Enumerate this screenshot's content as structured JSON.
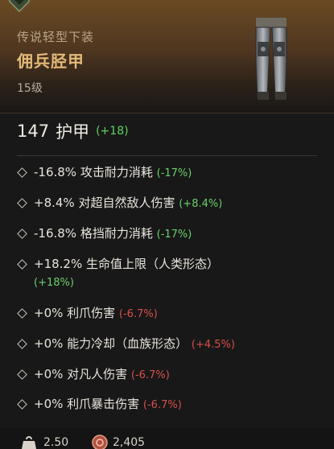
{
  "item": {
    "type": "传说轻型下装",
    "name": "佣兵胫甲",
    "level": "15级",
    "rarity_color": "#e3b979"
  },
  "armor": {
    "value": "147",
    "label": "护甲",
    "delta": "(+18)"
  },
  "stats": [
    {
      "text": "-16.8% 攻击耐力消耗",
      "delta": "(-17%)",
      "delta_color": "green"
    },
    {
      "text": "+8.4% 对超自然敌人伤害",
      "delta": "(+8.4%)",
      "delta_color": "green"
    },
    {
      "text": "-16.8% 格挡耐力消耗",
      "delta": "(-17%)",
      "delta_color": "green"
    },
    {
      "text": "+18.2% 生命值上限（人类形态）",
      "delta": "(+18%)",
      "delta_color": "green"
    },
    {
      "text": "+0% 利爪伤害",
      "delta": "(-6.7%)",
      "delta_color": "red"
    },
    {
      "text": "+0% 能力冷却（血族形态）",
      "delta": "(+4.5%)",
      "delta_color": "red"
    },
    {
      "text": "+0% 对凡人伤害",
      "delta": "(-6.7%)",
      "delta_color": "red"
    },
    {
      "text": "+0% 利爪暴击伤害",
      "delta": "(-6.7%)",
      "delta_color": "red"
    }
  ],
  "footer": {
    "weight": "2.50",
    "gold": "2,405",
    "weight_icon": "weight-icon",
    "gold_icon": "coin-icon"
  },
  "colors": {
    "positive": "#6ad06a",
    "negative": "#d8504a",
    "header_gradient_top": "#6a4a24"
  }
}
